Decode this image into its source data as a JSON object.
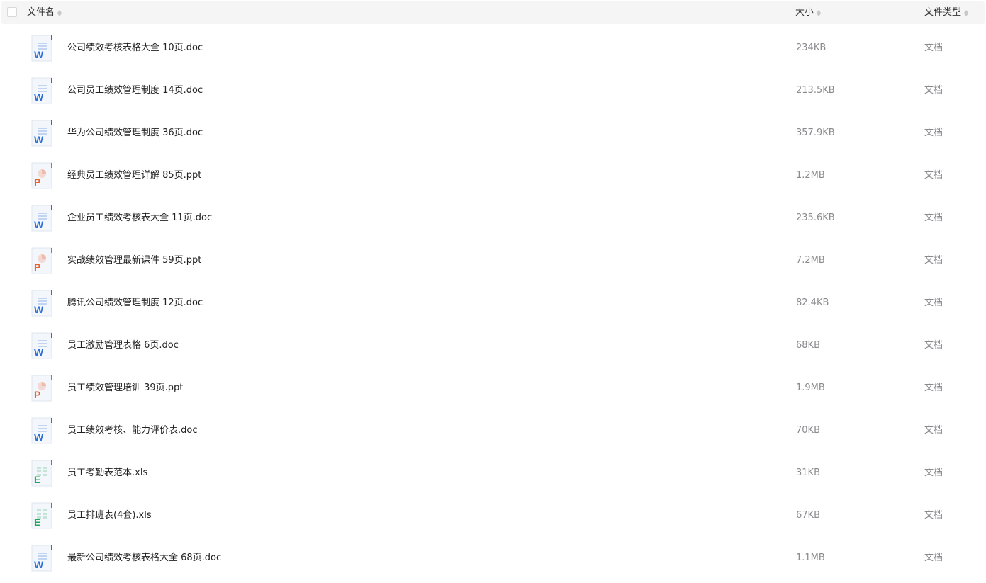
{
  "header": {
    "name_label": "文件名",
    "size_label": "大小",
    "type_label": "文件类型"
  },
  "icon_colors": {
    "word": "#2b6fd6",
    "ppt": "#e8602c",
    "excel": "#23a55a"
  },
  "files": [
    {
      "name": "公司绩效考核表格大全 10页.doc",
      "size": "234KB",
      "type": "文档",
      "icon": "word"
    },
    {
      "name": "公司员工绩效管理制度 14页.doc",
      "size": "213.5KB",
      "type": "文档",
      "icon": "word"
    },
    {
      "name": "华为公司绩效管理制度 36页.doc",
      "size": "357.9KB",
      "type": "文档",
      "icon": "word"
    },
    {
      "name": "经典员工绩效管理详解 85页.ppt",
      "size": "1.2MB",
      "type": "文档",
      "icon": "ppt"
    },
    {
      "name": "企业员工绩效考核表大全 11页.doc",
      "size": "235.6KB",
      "type": "文档",
      "icon": "word"
    },
    {
      "name": "实战绩效管理最新课件 59页.ppt",
      "size": "7.2MB",
      "type": "文档",
      "icon": "ppt"
    },
    {
      "name": "腾讯公司绩效管理制度 12页.doc",
      "size": "82.4KB",
      "type": "文档",
      "icon": "word"
    },
    {
      "name": "员工激励管理表格 6页.doc",
      "size": "68KB",
      "type": "文档",
      "icon": "word"
    },
    {
      "name": "员工绩效管理培训 39页.ppt",
      "size": "1.9MB",
      "type": "文档",
      "icon": "ppt"
    },
    {
      "name": "员工绩效考核、能力评价表.doc",
      "size": "70KB",
      "type": "文档",
      "icon": "word"
    },
    {
      "name": "员工考勤表范本.xls",
      "size": "31KB",
      "type": "文档",
      "icon": "excel"
    },
    {
      "name": "员工排班表(4套).xls",
      "size": "67KB",
      "type": "文档",
      "icon": "excel"
    },
    {
      "name": "最新公司绩效考核表格大全 68页.doc",
      "size": "1.1MB",
      "type": "文档",
      "icon": "word"
    }
  ]
}
